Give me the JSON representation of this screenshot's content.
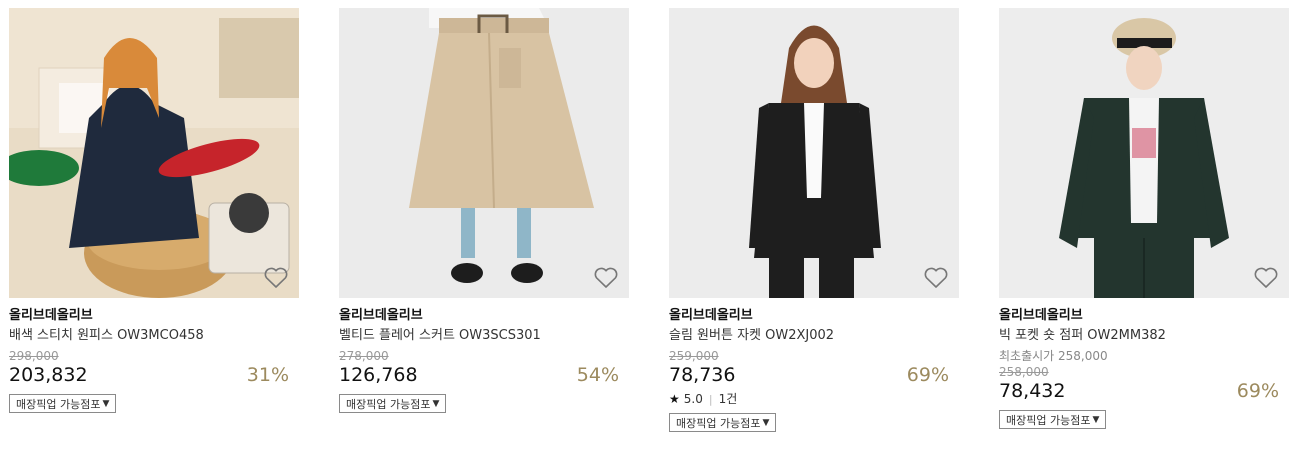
{
  "products": [
    {
      "brand": "올리브데올리브",
      "name": "배색 스티치 원피스 OW3MCO458",
      "original_price": "298,000",
      "price": "203,832",
      "discount": "31%",
      "pickup_label": "매장픽업 가능점포"
    },
    {
      "brand": "올리브데올리브",
      "name": "벨티드 플레어 스커트 OW3SCS301",
      "original_price": "278,000",
      "price": "126,768",
      "discount": "54%",
      "pickup_label": "매장픽업 가능점포"
    },
    {
      "brand": "올리브데올리브",
      "name": "슬림 원버튼 자켓 OW2XJ002",
      "original_price": "259,000",
      "price": "78,736",
      "discount": "69%",
      "rating": "5.0",
      "review_count": "1건",
      "pickup_label": "매장픽업 가능점포"
    },
    {
      "brand": "올리브데올리브",
      "name": "빅 포켓 숏 점퍼 OW2MM382",
      "first_release_label": "최초출시가 258,000",
      "original_price": "258,000",
      "price": "78,432",
      "discount": "69%",
      "pickup_label": "매장픽업 가능점포"
    }
  ],
  "icons": {
    "wishlist": "heart-outline-icon",
    "dropdown": "caret-down-icon",
    "rating": "star-icon"
  },
  "colors": {
    "discount": "#9c8a5e",
    "price": "#111111",
    "strike": "#999999"
  }
}
